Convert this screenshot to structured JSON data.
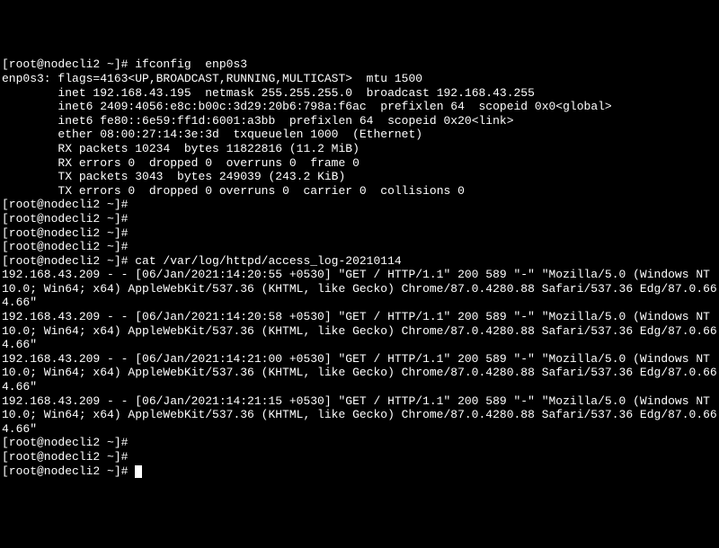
{
  "terminal": {
    "lines": [
      "[root@nodecli2 ~]# ifconfig  enp0s3",
      "enp0s3: flags=4163<UP,BROADCAST,RUNNING,MULTICAST>  mtu 1500",
      "        inet 192.168.43.195  netmask 255.255.255.0  broadcast 192.168.43.255",
      "        inet6 2409:4056:e8c:b00c:3d29:20b6:798a:f6ac  prefixlen 64  scopeid 0x0<global>",
      "        inet6 fe80::6e59:ff1d:6001:a3bb  prefixlen 64  scopeid 0x20<link>",
      "        ether 08:00:27:14:3e:3d  txqueuelen 1000  (Ethernet)",
      "        RX packets 10234  bytes 11822816 (11.2 MiB)",
      "        RX errors 0  dropped 0  overruns 0  frame 0",
      "        TX packets 3043  bytes 249039 (243.2 KiB)",
      "        TX errors 0  dropped 0 overruns 0  carrier 0  collisions 0",
      "",
      "[root@nodecli2 ~]#",
      "[root@nodecli2 ~]#",
      "[root@nodecli2 ~]#",
      "[root@nodecli2 ~]#",
      "[root@nodecli2 ~]# cat /var/log/httpd/access_log-20210114",
      "192.168.43.209 - - [06/Jan/2021:14:20:55 +0530] \"GET / HTTP/1.1\" 200 589 \"-\" \"Mozilla/5.0 (Windows NT 10.0; Win64; x64) AppleWebKit/537.36 (KHTML, like Gecko) Chrome/87.0.4280.88 Safari/537.36 Edg/87.0.664.66\"",
      "192.168.43.209 - - [06/Jan/2021:14:20:58 +0530] \"GET / HTTP/1.1\" 200 589 \"-\" \"Mozilla/5.0 (Windows NT 10.0; Win64; x64) AppleWebKit/537.36 (KHTML, like Gecko) Chrome/87.0.4280.88 Safari/537.36 Edg/87.0.664.66\"",
      "192.168.43.209 - - [06/Jan/2021:14:21:00 +0530] \"GET / HTTP/1.1\" 200 589 \"-\" \"Mozilla/5.0 (Windows NT 10.0; Win64; x64) AppleWebKit/537.36 (KHTML, like Gecko) Chrome/87.0.4280.88 Safari/537.36 Edg/87.0.664.66\"",
      "192.168.43.209 - - [06/Jan/2021:14:21:15 +0530] \"GET / HTTP/1.1\" 200 589 \"-\" \"Mozilla/5.0 (Windows NT 10.0; Win64; x64) AppleWebKit/537.36 (KHTML, like Gecko) Chrome/87.0.4280.88 Safari/537.36 Edg/87.0.664.66\"",
      "[root@nodecli2 ~]#",
      "[root@nodecli2 ~]#",
      "[root@nodecli2 ~]# "
    ]
  }
}
